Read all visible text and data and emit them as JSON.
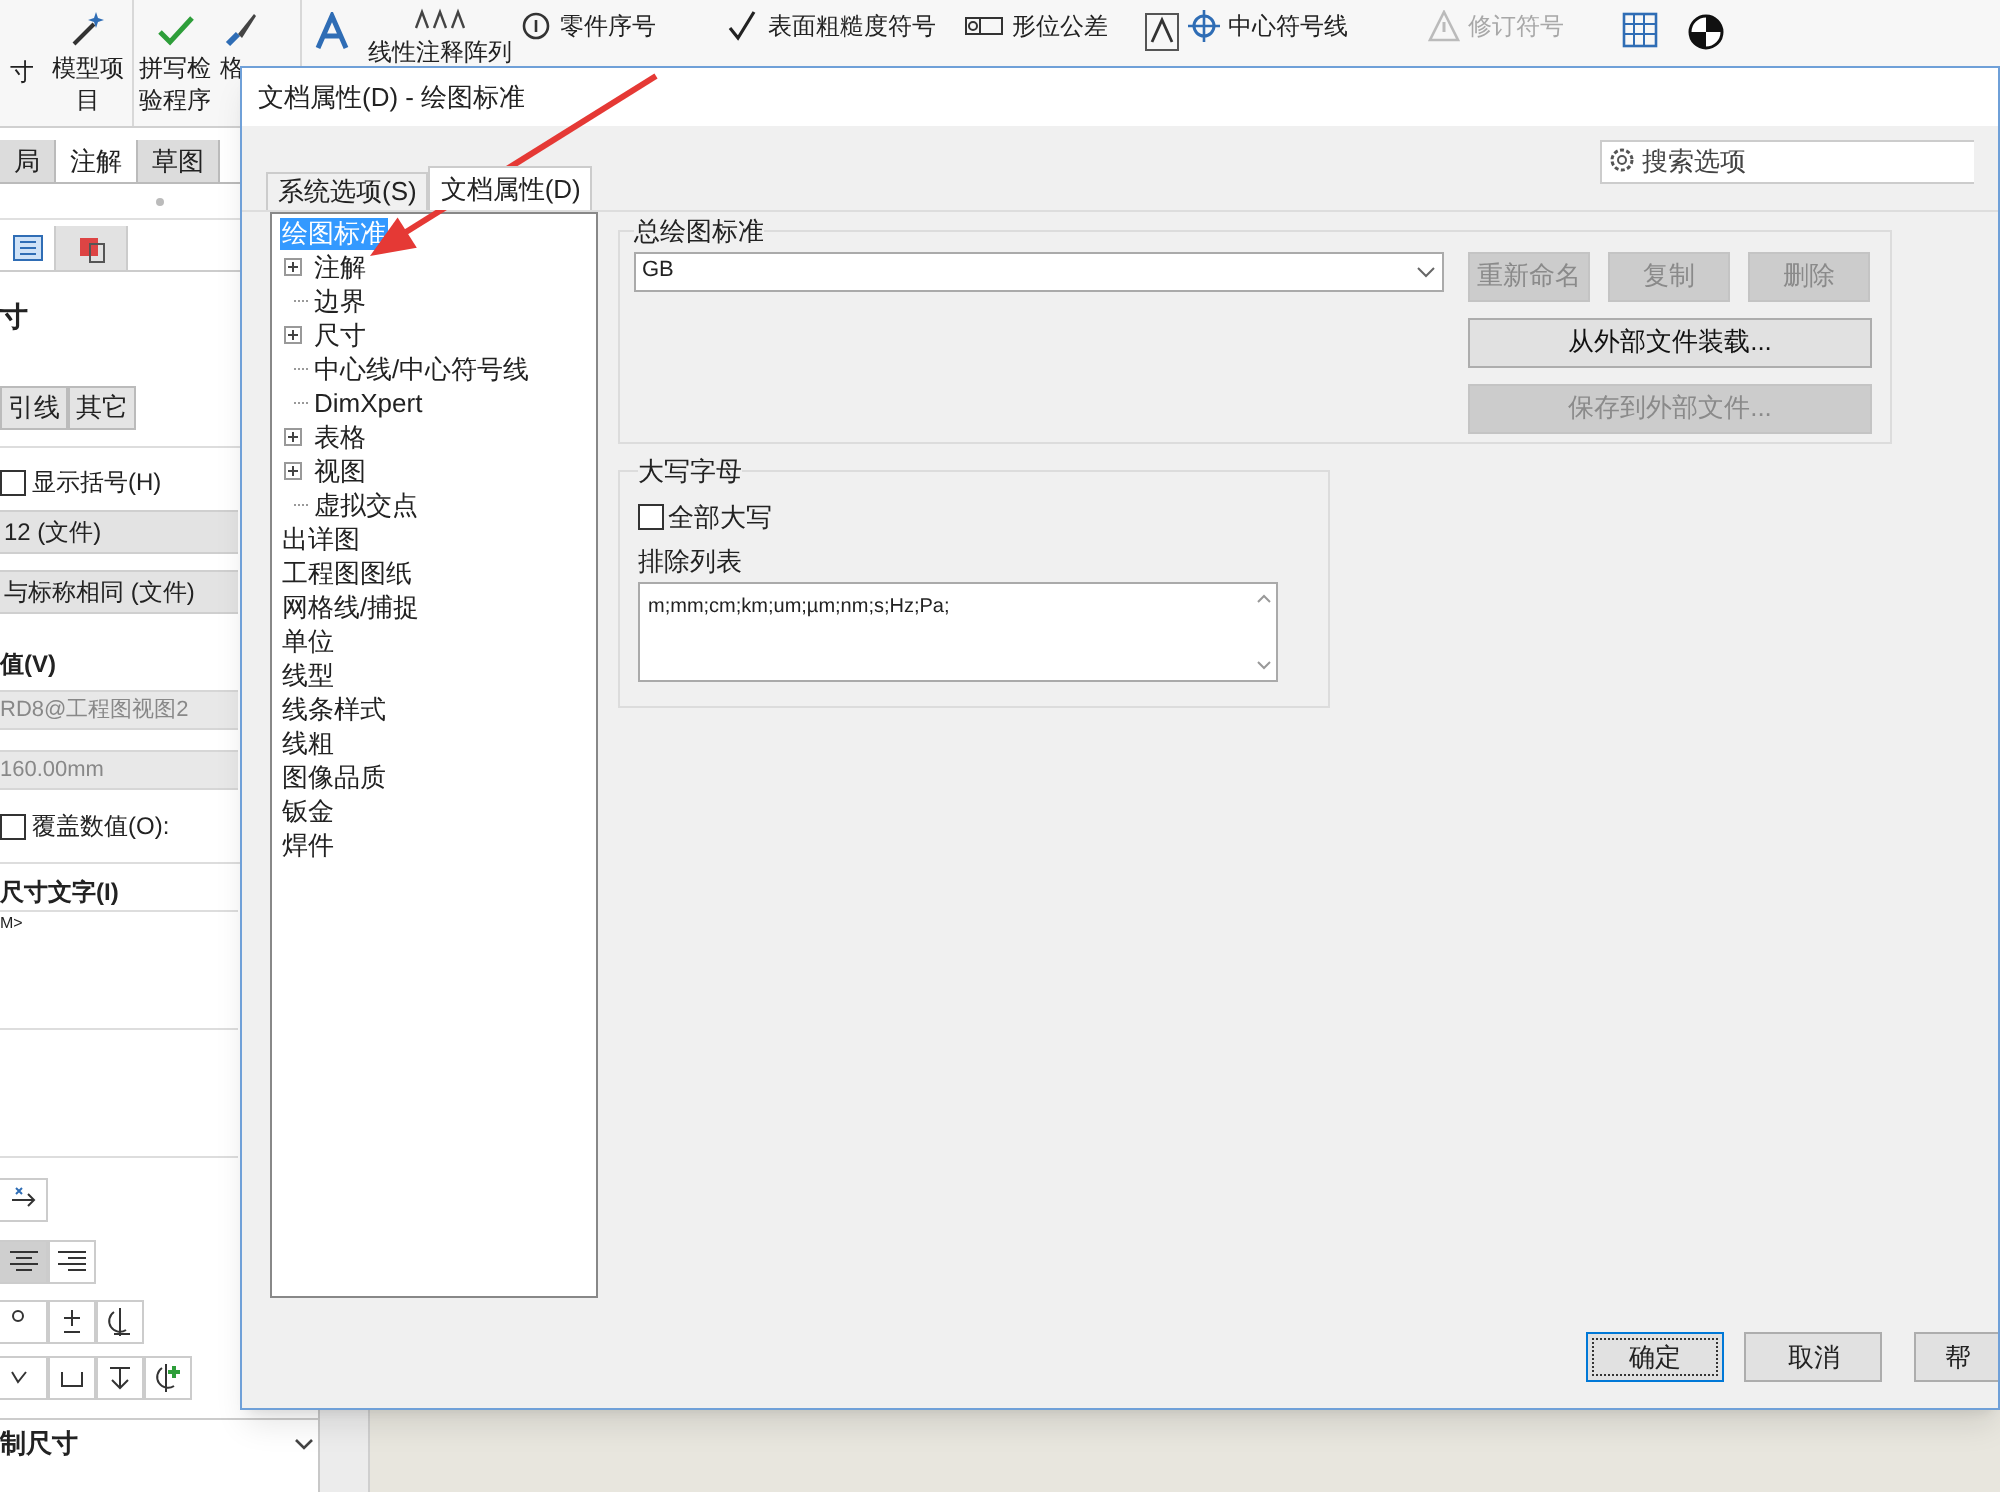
{
  "toolbar": {
    "items": [
      {
        "kind": "large",
        "label": "寸",
        "disabled": false
      },
      {
        "kind": "large",
        "label": "模型项目",
        "disabled": false
      },
      {
        "kind": "large",
        "label": "拼写检验程序",
        "disabled": false
      },
      {
        "kind": "large",
        "label": "格",
        "disabled": false
      },
      {
        "kind": "icon",
        "disabled": false
      },
      {
        "kind": "large",
        "label": "线性注释阵列",
        "disabled": false
      },
      {
        "kind": "small",
        "label": "零件序号",
        "disabled": false
      },
      {
        "kind": "small",
        "label": "表面粗糙度符号",
        "disabled": false
      },
      {
        "kind": "small",
        "label": "形位公差",
        "disabled": false
      },
      {
        "kind": "icon",
        "disabled": false
      },
      {
        "kind": "small",
        "label": "中心符号线",
        "disabled": false
      },
      {
        "kind": "small",
        "label": "修订符号",
        "disabled": true
      },
      {
        "kind": "icon",
        "disabled": false
      },
      {
        "kind": "icon",
        "disabled": false
      }
    ]
  },
  "left_panel": {
    "tabs": [
      {
        "label": "局",
        "selected": false
      },
      {
        "label": "注解",
        "selected": true
      },
      {
        "label": "草图",
        "selected": false
      }
    ],
    "icon_tabs": [
      {
        "selected": true
      },
      {
        "selected": false
      }
    ],
    "heading": "寸",
    "sub_tabs": [
      {
        "label": "引线",
        "selected": false
      },
      {
        "label": "其它",
        "selected": false
      }
    ],
    "show_parentheses": {
      "label": "显示括号(H)",
      "checked": false
    },
    "rows": [
      "12 (文件)",
      "与标称相同 (文件)"
    ],
    "value_label": "值(V)",
    "value_fields": [
      "RD8@工程图视图2",
      "160.00mm"
    ],
    "override": {
      "label": "覆盖数值(O):",
      "checked": false
    },
    "text_label": "尺寸文字(I)",
    "text_value": "M>",
    "bottom_label": "制尺寸"
  },
  "dialog": {
    "title": "文档属性(D) - 绘图标准",
    "tabs": [
      {
        "label": "系统选项(S)",
        "selected": false
      },
      {
        "label": "文档属性(D)",
        "selected": true
      }
    ],
    "search": {
      "placeholder": "搜索选项"
    },
    "tree": [
      {
        "label": "绘图标准",
        "selected": true,
        "children": [
          {
            "label": "注解",
            "selected": false,
            "expanded": false
          },
          {
            "label": "边界",
            "selected": false
          },
          {
            "label": "尺寸",
            "selected": false,
            "expanded": false
          },
          {
            "label": "中心线/中心符号线",
            "selected": false
          },
          {
            "label": "DimXpert",
            "selected": false
          },
          {
            "label": "表格",
            "selected": false,
            "expanded": false
          },
          {
            "label": "视图",
            "selected": false,
            "expanded": false
          },
          {
            "label": "虚拟交点",
            "selected": false
          }
        ]
      },
      {
        "label": "出详图",
        "selected": false
      },
      {
        "label": "工程图图纸",
        "selected": false
      },
      {
        "label": "网格线/捕捉",
        "selected": false
      },
      {
        "label": "单位",
        "selected": false
      },
      {
        "label": "线型",
        "selected": false
      },
      {
        "label": "线条样式",
        "selected": false
      },
      {
        "label": "线粗",
        "selected": false
      },
      {
        "label": "图像品质",
        "selected": false
      },
      {
        "label": "钣金",
        "selected": false
      },
      {
        "label": "焊件",
        "selected": false
      }
    ],
    "standard_group": {
      "title": "总绘图标准",
      "value": "GB",
      "buttons": [
        {
          "label": "重新命名",
          "disabled": true
        },
        {
          "label": "复制",
          "disabled": true
        },
        {
          "label": "删除",
          "disabled": true
        },
        {
          "label": "从外部文件装载...",
          "disabled": false
        },
        {
          "label": "保存到外部文件...",
          "disabled": true
        }
      ]
    },
    "caps_group": {
      "title": "大写字母",
      "all_caps": {
        "label": "全部大写",
        "checked": false
      },
      "exclude_label": "排除列表",
      "exclude_value": "m;mm;cm;km;um;µm;nm;s;Hz;Pa;"
    },
    "buttons": [
      {
        "label": "确定",
        "focused": true
      },
      {
        "label": "取消",
        "focused": false
      },
      {
        "label": "帮",
        "focused": false
      }
    ]
  }
}
